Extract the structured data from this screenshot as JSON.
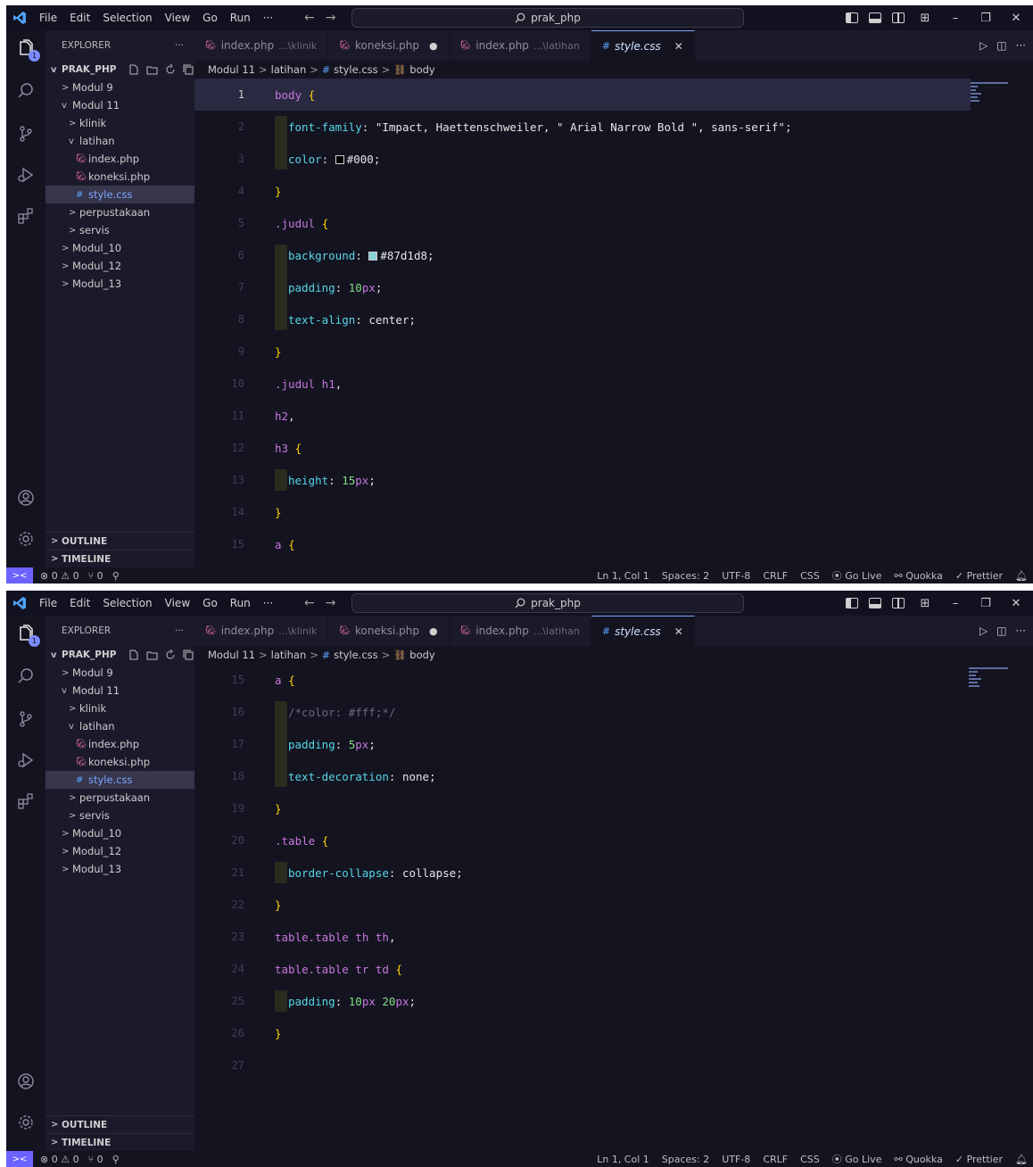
{
  "titlebar": {
    "menu": [
      "File",
      "Edit",
      "Selection",
      "View",
      "Go",
      "Run",
      "···"
    ],
    "search": "prak_php"
  },
  "explorer": {
    "title": "EXPLORER",
    "more": "···",
    "root": "PRAK_PHP",
    "tree": [
      {
        "label": "Modul 9",
        "depth": 0,
        "chevron": ">",
        "type": "folder"
      },
      {
        "label": "Modul 11",
        "depth": 0,
        "chevron": "v",
        "type": "folder"
      },
      {
        "label": "klinik",
        "depth": 1,
        "chevron": ">",
        "type": "folder"
      },
      {
        "label": "latihan",
        "depth": 1,
        "chevron": "v",
        "type": "folder"
      },
      {
        "label": "index.php",
        "depth": 2,
        "chevron": "",
        "type": "php"
      },
      {
        "label": "koneksi.php",
        "depth": 2,
        "chevron": "",
        "type": "php"
      },
      {
        "label": "style.css",
        "depth": 2,
        "chevron": "",
        "type": "css",
        "selected": true
      },
      {
        "label": "perpustakaan",
        "depth": 1,
        "chevron": ">",
        "type": "folder"
      },
      {
        "label": "servis",
        "depth": 1,
        "chevron": ">",
        "type": "folder"
      },
      {
        "label": "Modul_10",
        "depth": 0,
        "chevron": ">",
        "type": "folder"
      },
      {
        "label": "Modul_12",
        "depth": 0,
        "chevron": ">",
        "type": "folder"
      },
      {
        "label": "Modul_13",
        "depth": 0,
        "chevron": ">",
        "type": "folder"
      }
    ],
    "outline": "OUTLINE",
    "timeline": "TIMELINE"
  },
  "tabs": [
    {
      "label": "index.php",
      "path": "...\\klinik",
      "type": "php"
    },
    {
      "label": "koneksi.php",
      "type": "php",
      "modified": true
    },
    {
      "label": "index.php",
      "path": "...\\latihan",
      "type": "php"
    },
    {
      "label": "style.css",
      "type": "css",
      "active": true
    }
  ],
  "breadcrumb": [
    "Modul 11",
    "latihan",
    "style.css",
    "body"
  ],
  "accent_color": "#6b63ff",
  "swatches": {
    "black": "#000",
    "teal": "#87d1d8"
  },
  "panes": [
    {
      "lines": [
        {
          "n": "1",
          "tokens": [
            [
              "sel",
              "body"
            ],
            [
              "punc",
              " "
            ],
            [
              "brace",
              "{"
            ]
          ],
          "current": true
        },
        {
          "n": "2",
          "tokens": [
            [
              "prop",
              "font-family"
            ],
            [
              "punc",
              ": "
            ],
            [
              "str",
              "\"Impact, Haettenschweiler, \" Arial Narrow Bold \", sans-serif\""
            ],
            [
              "punc",
              ";"
            ]
          ],
          "indent": true
        },
        {
          "n": "3",
          "tokens": [
            [
              "prop",
              "color"
            ],
            [
              "punc",
              ": "
            ],
            [
              "swatch",
              "black"
            ],
            [
              "str",
              "#000"
            ],
            [
              "punc",
              ";"
            ]
          ],
          "indent": true
        },
        {
          "n": "4",
          "tokens": [
            [
              "brace",
              "}"
            ]
          ]
        },
        {
          "n": "5",
          "tokens": [
            [
              "sel",
              ".judul"
            ],
            [
              "punc",
              " "
            ],
            [
              "brace",
              "{"
            ]
          ]
        },
        {
          "n": "6",
          "tokens": [
            [
              "prop",
              "background"
            ],
            [
              "punc",
              ": "
            ],
            [
              "swatch",
              "teal"
            ],
            [
              "str",
              "#87d1d8"
            ],
            [
              "punc",
              ";"
            ]
          ],
          "indent": true
        },
        {
          "n": "7",
          "tokens": [
            [
              "prop",
              "padding"
            ],
            [
              "punc",
              ": "
            ],
            [
              "num",
              "10"
            ],
            [
              "unit",
              "px"
            ],
            [
              "punc",
              ";"
            ]
          ],
          "indent": true
        },
        {
          "n": "8",
          "tokens": [
            [
              "prop",
              "text-align"
            ],
            [
              "punc",
              ": "
            ],
            [
              "str",
              "center"
            ],
            [
              "punc",
              ";"
            ]
          ],
          "indent": true
        },
        {
          "n": "9",
          "tokens": [
            [
              "brace",
              "}"
            ]
          ]
        },
        {
          "n": "10",
          "tokens": [
            [
              "sel",
              ".judul h1"
            ],
            [
              "punc",
              ","
            ]
          ]
        },
        {
          "n": "11",
          "tokens": [
            [
              "sel",
              "h2"
            ],
            [
              "punc",
              ","
            ]
          ]
        },
        {
          "n": "12",
          "tokens": [
            [
              "sel",
              "h3"
            ],
            [
              "punc",
              " "
            ],
            [
              "brace",
              "{"
            ]
          ]
        },
        {
          "n": "13",
          "tokens": [
            [
              "prop",
              "height"
            ],
            [
              "punc",
              ": "
            ],
            [
              "num",
              "15"
            ],
            [
              "unit",
              "px"
            ],
            [
              "punc",
              ";"
            ]
          ],
          "indent": true
        },
        {
          "n": "14",
          "tokens": [
            [
              "brace",
              "}"
            ]
          ]
        },
        {
          "n": "15",
          "tokens": [
            [
              "sel",
              "a"
            ],
            [
              "punc",
              " "
            ],
            [
              "brace",
              "{"
            ]
          ]
        }
      ]
    },
    {
      "lines": [
        {
          "n": "15",
          "tokens": [
            [
              "sel",
              "a"
            ],
            [
              "punc",
              " "
            ],
            [
              "brace",
              "{"
            ]
          ]
        },
        {
          "n": "16",
          "tokens": [
            [
              "cmt",
              "/*color: #fff;*/"
            ]
          ],
          "indent": true
        },
        {
          "n": "17",
          "tokens": [
            [
              "prop",
              "padding"
            ],
            [
              "punc",
              ": "
            ],
            [
              "num",
              "5"
            ],
            [
              "unit",
              "px"
            ],
            [
              "punc",
              ";"
            ]
          ],
          "indent": true
        },
        {
          "n": "18",
          "tokens": [
            [
              "prop",
              "text-decoration"
            ],
            [
              "punc",
              ": "
            ],
            [
              "str",
              "none"
            ],
            [
              "punc",
              ";"
            ]
          ],
          "indent": true
        },
        {
          "n": "19",
          "tokens": [
            [
              "brace",
              "}"
            ]
          ]
        },
        {
          "n": "20",
          "tokens": [
            [
              "sel",
              ".table"
            ],
            [
              "punc",
              " "
            ],
            [
              "brace",
              "{"
            ]
          ]
        },
        {
          "n": "21",
          "tokens": [
            [
              "prop",
              "border-collapse"
            ],
            [
              "punc",
              ": "
            ],
            [
              "str",
              "collapse"
            ],
            [
              "punc",
              ";"
            ]
          ],
          "indent": true
        },
        {
          "n": "22",
          "tokens": [
            [
              "brace",
              "}"
            ]
          ]
        },
        {
          "n": "23",
          "tokens": [
            [
              "sel",
              "table.table th th"
            ],
            [
              "punc",
              ","
            ]
          ]
        },
        {
          "n": "24",
          "tokens": [
            [
              "sel",
              "table.table tr td"
            ],
            [
              "punc",
              " "
            ],
            [
              "brace",
              "{"
            ]
          ]
        },
        {
          "n": "25",
          "tokens": [
            [
              "prop",
              "padding"
            ],
            [
              "punc",
              ": "
            ],
            [
              "num",
              "10"
            ],
            [
              "unit",
              "px"
            ],
            [
              "punc",
              " "
            ],
            [
              "num",
              "20"
            ],
            [
              "unit",
              "px"
            ],
            [
              "punc",
              ";"
            ]
          ],
          "indent": true
        },
        {
          "n": "26",
          "tokens": [
            [
              "brace",
              "}"
            ]
          ]
        },
        {
          "n": "27",
          "tokens": []
        }
      ]
    }
  ],
  "status": {
    "problems": "⊗ 0 ⚠ 0",
    "ports": "⑂ 0",
    "position": "Ln 1, Col 1",
    "spaces": "Spaces: 2",
    "encoding": "UTF-8",
    "eol": "CRLF",
    "language": "CSS",
    "golive": "Go Live",
    "quokka": "Quokka",
    "prettier": "Prettier"
  }
}
